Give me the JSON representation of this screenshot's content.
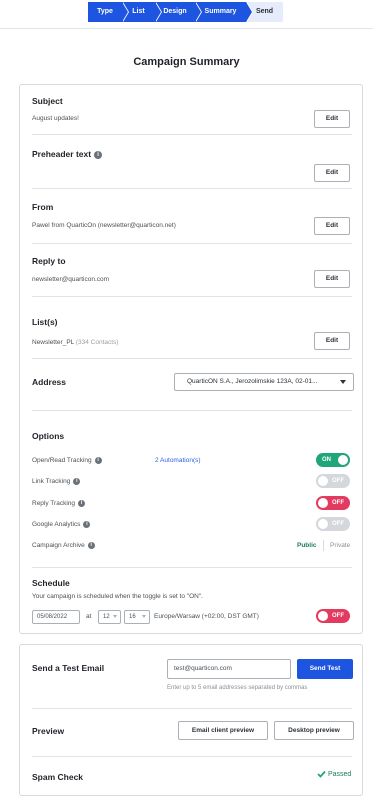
{
  "stepper": [
    {
      "label": "Type",
      "state": "active"
    },
    {
      "label": "List",
      "state": "active"
    },
    {
      "label": "Design",
      "state": "active"
    },
    {
      "label": "Summary",
      "state": "active"
    },
    {
      "label": "Send",
      "state": "inactive"
    }
  ],
  "page_title": "Campaign Summary",
  "summary": {
    "subject": {
      "label": "Subject",
      "value": "August updates!",
      "edit": "Edit"
    },
    "preheader": {
      "label": "Preheader text",
      "value": "",
      "edit": "Edit"
    },
    "from": {
      "label": "From",
      "value": "Pawel from QuarticOn (newsletter@quarticon.net)",
      "edit": "Edit"
    },
    "reply_to": {
      "label": "Reply to",
      "value": "newsletter@quarticon.com",
      "edit": "Edit"
    },
    "lists": {
      "label": "List(s)",
      "value": "Newsletter_PL",
      "count": "(334 Contacts)",
      "edit": "Edit"
    },
    "address": {
      "label": "Address",
      "selected": "QuarticON S.A., Jerozolimskie 123A, 02-01..."
    }
  },
  "options": {
    "title": "Options",
    "open_read": {
      "label": "Open/Read Tracking",
      "link": "2 Automation(s)",
      "toggle": "ON"
    },
    "link_tracking": {
      "label": "Link Tracking",
      "toggle": "OFF"
    },
    "reply_tracking": {
      "label": "Reply Tracking",
      "toggle": "OFF"
    },
    "google_analytics": {
      "label": "Google Analytics",
      "toggle": "OFF"
    },
    "campaign_archive": {
      "label": "Campaign Archive",
      "public": "Public",
      "private": "Private"
    }
  },
  "schedule": {
    "title": "Schedule",
    "note": "Your campaign is scheduled when the toggle is set to \"ON\".",
    "date": "05/08/2022",
    "at": "at",
    "hour": "12",
    "minute": "16",
    "timezone": "Europe/Warsaw (+02:00, DST GMT)",
    "toggle": "OFF"
  },
  "test_email": {
    "title": "Send a Test Email",
    "value": "test@quarticon.com",
    "button": "Send Test",
    "hint": "Enter up to 5 email addresses separated by commas"
  },
  "preview": {
    "title": "Preview",
    "email_client": "Email client preview",
    "desktop": "Desktop preview"
  },
  "spam": {
    "title": "Spam Check",
    "status": "Passed"
  },
  "colors": {
    "primary": "#1d55e0",
    "on": "#21a67a",
    "off_red": "#e33b5f",
    "off_grey": "#d4d7db"
  }
}
